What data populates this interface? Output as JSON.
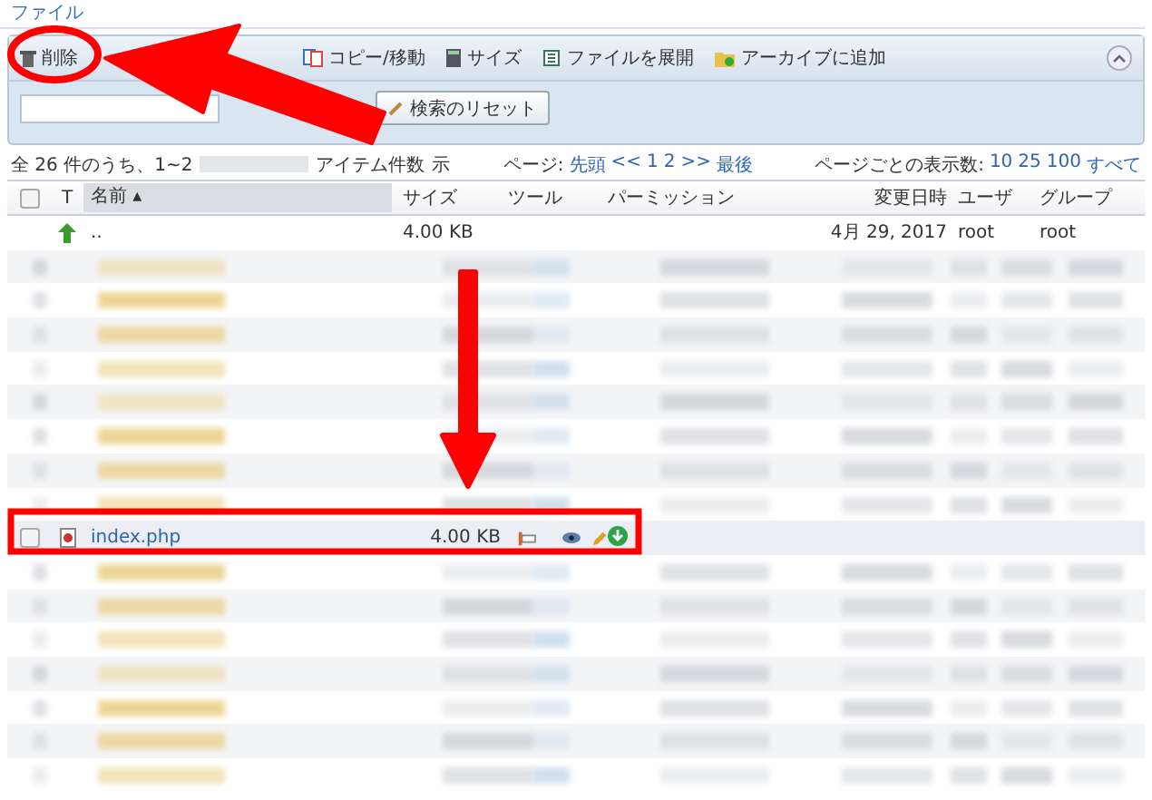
{
  "section_title": "ファイル",
  "toolbar": [
    {
      "kind": "trash",
      "label": "削除"
    },
    {
      "kind": "copy",
      "label": "コピー/移動"
    },
    {
      "kind": "size",
      "label": "サイズ"
    },
    {
      "kind": "extract",
      "label": "ファイルを展開"
    },
    {
      "kind": "archive",
      "label": "アーカイブに追加"
    }
  ],
  "reset_button": "検索のリセット",
  "info": {
    "count": "全 26 件のうち、1~2",
    "items": "アイテム件数",
    "tail": "示"
  },
  "pagination": {
    "label": "ページ:",
    "first": "先頭",
    "prev": "<<",
    "pages": [
      "1",
      "2"
    ],
    "next": ">>",
    "last": "最後"
  },
  "per_page": {
    "label": "ページごとの表示数:",
    "options": [
      "10",
      "25",
      "100",
      "すべて"
    ]
  },
  "table": {
    "select_all_checked": false,
    "sort_indicator": "▴",
    "columns": [
      "T",
      "名前",
      "サイズ",
      "ツール",
      "パーミッション",
      "変更日時",
      "ユーザ",
      "グループ"
    ],
    "rows": [
      {
        "kind": "parent",
        "name": "..",
        "size": "4.00 KB",
        "date": "4月 29, 2017",
        "user": "root",
        "group": "root"
      },
      {
        "kind": "blurred"
      },
      {
        "kind": "blurred"
      },
      {
        "kind": "blurred"
      },
      {
        "kind": "blurred"
      },
      {
        "kind": "blurred"
      },
      {
        "kind": "blurred"
      },
      {
        "kind": "blurred"
      },
      {
        "kind": "blurred"
      },
      {
        "kind": "file",
        "name": "index.php",
        "size": "4.00 KB",
        "checked": false
      },
      {
        "kind": "blurred"
      },
      {
        "kind": "blurred"
      },
      {
        "kind": "blurred"
      },
      {
        "kind": "blurred"
      },
      {
        "kind": "blurred"
      },
      {
        "kind": "blurred"
      },
      {
        "kind": "blurred"
      }
    ]
  },
  "annotations": [
    {
      "kind": "ellipse"
    },
    {
      "kind": "arrow-left"
    },
    {
      "kind": "arrow-down"
    },
    {
      "kind": "highlight-box"
    }
  ]
}
